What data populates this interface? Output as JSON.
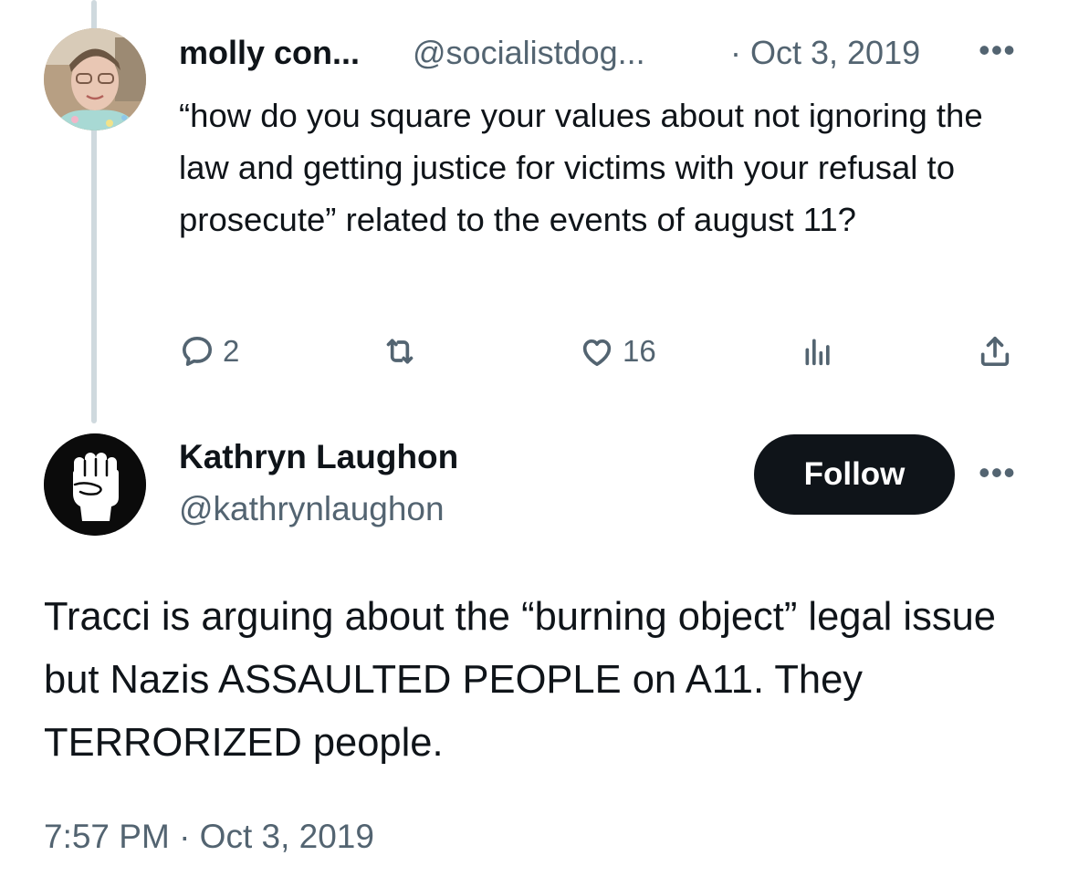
{
  "parent_tweet": {
    "author_name": "molly con...",
    "author_handle": "@socialistdog...",
    "date": "· Oct 3, 2019",
    "more": "•••",
    "text": "“how do you square your values about not ignoring the law and getting justice for victims with your refusal to prosecute” related to the events of august 11?",
    "replies_count": "2",
    "likes_count": "16",
    "icons": [
      "reply-icon",
      "retweet-icon",
      "like-icon",
      "views-icon",
      "share-icon"
    ]
  },
  "main_tweet": {
    "author_name": "Kathryn Laughon",
    "author_handle": "@kathrynlaughon",
    "follow_label": "Follow",
    "more": "•••",
    "text": "Tracci is arguing about the “burning object” legal issue but Nazis ASSAULTED PEOPLE on A11. They TERRORIZED people.",
    "timestamp": "7:57 PM · Oct 3, 2019",
    "avatar_icon": "raised-fist-icon"
  },
  "colors": {
    "text": "#0f1419",
    "muted": "#536471",
    "thread_line": "#cfd9de",
    "button_bg": "#0f1419",
    "button_text": "#ffffff",
    "background": "#ffffff"
  }
}
